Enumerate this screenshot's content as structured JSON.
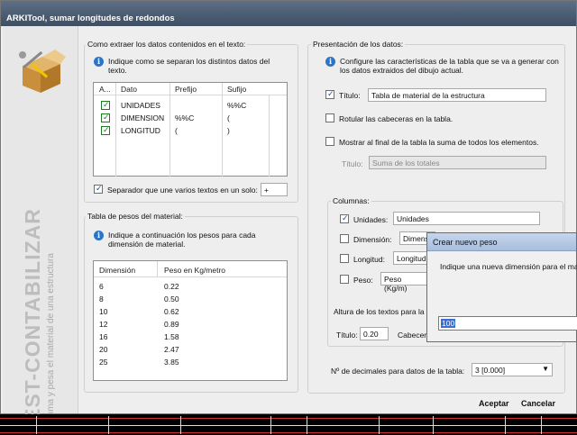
{
  "window": {
    "title": "ARKITool, sumar longitudes de redondos"
  },
  "sidebar": {
    "brand": "EST-CONTABILIZAR",
    "subtitle": "Suma y pesa el material de una estructura",
    "icon": "box-tools-icon"
  },
  "extract": {
    "title": "Como extraer los datos contenidos en el texto:",
    "info": "Indique como se separan los distintos datos del texto.",
    "columns": [
      "A...",
      "Dato",
      "Prefijo",
      "Sufijo"
    ],
    "rows": [
      {
        "checked": true,
        "dato": "UNIDADES",
        "prefijo": "",
        "sufijo": "%%C"
      },
      {
        "checked": true,
        "dato": "DIMENSION",
        "prefijo": "%%C",
        "sufijo": "("
      },
      {
        "checked": true,
        "dato": "LONGITUD",
        "prefijo": "(",
        "sufijo": ")"
      }
    ],
    "separator_label": "Separador que une varios textos en un solo:",
    "separator_checked": true,
    "separator_value": "+"
  },
  "weights": {
    "title": "Tabla de pesos del material:",
    "info": "Indique a continuación los pesos para cada dimensión de material.",
    "columns": [
      "Dimensión",
      "Peso en Kg/metro"
    ],
    "rows": [
      {
        "dim": "6",
        "peso": "0.22"
      },
      {
        "dim": "8",
        "peso": "0.50"
      },
      {
        "dim": "10",
        "peso": "0.62"
      },
      {
        "dim": "12",
        "peso": "0.89"
      },
      {
        "dim": "16",
        "peso": "1.58"
      },
      {
        "dim": "20",
        "peso": "2.47"
      },
      {
        "dim": "25",
        "peso": "3.85"
      }
    ]
  },
  "presentation": {
    "title": "Presentación de los datos:",
    "info": "Configure las características de la tabla que se va a generar con los datos extraidos del dibujo actual.",
    "titulo_label": "Título:",
    "titulo_checked": true,
    "titulo_value": "Tabla de material de la estructura",
    "rotular_label": "Rotular las cabeceras en la tabla.",
    "rotular_checked": false,
    "mostrar_label": "Mostrar al final de la tabla la suma de todos los elementos.",
    "mostrar_checked": false,
    "sum_title_label": "Título:",
    "sum_title_value": "Suma de los totales"
  },
  "columns": {
    "title": "Columnas:",
    "items": [
      {
        "label": "Unidades:",
        "checked": true,
        "value": "Unidades"
      },
      {
        "label": "Dimensión:",
        "checked": false,
        "value": "Dimens"
      },
      {
        "label": "Longitud:",
        "checked": false,
        "value": "Longitud"
      },
      {
        "label": "Peso:",
        "checked": false,
        "value": "Peso (Kg/m)"
      }
    ],
    "altura_label": "Altura de los textos para la ta",
    "titulo_label": "Título:",
    "titulo_value": "0.20",
    "cabecera_label": "Cabecer"
  },
  "decimals": {
    "label": "Nº de decimales para datos de la tabla:",
    "value": "3 [0.000]"
  },
  "buttons": {
    "accept": "Aceptar",
    "cancel": "Cancelar"
  },
  "popup": {
    "title": "Crear nuevo peso",
    "message": "Indique una nueva dimensión para el ma",
    "value": "100"
  },
  "colors": {
    "titlebar": "#4a5a70",
    "accent": "#2b74c8",
    "check_green": "#1e7b22"
  }
}
